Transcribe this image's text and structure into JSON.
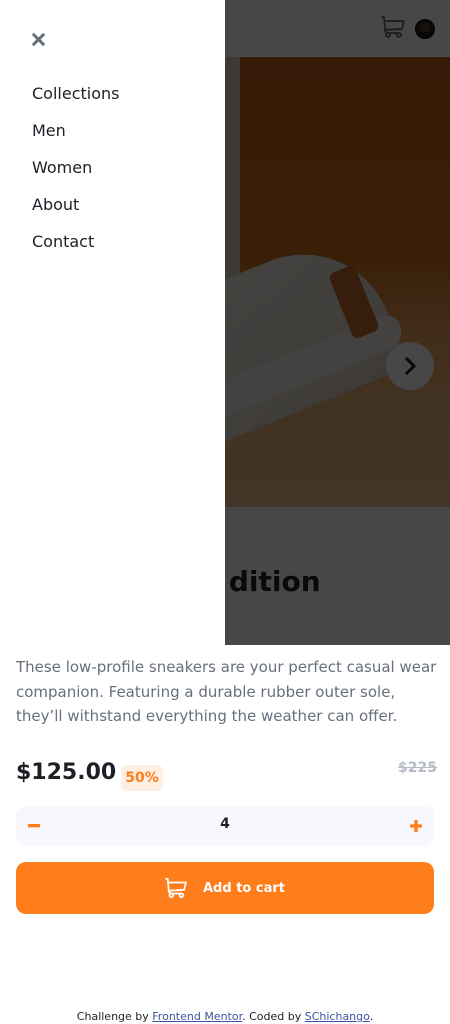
{
  "header": {
    "cart_icon": "cart-icon",
    "avatar": "user-avatar"
  },
  "hero": {
    "next_icon": "chevron-right-icon"
  },
  "product": {
    "title": "Fall Limited Edition Sneakers",
    "visible_title_fragment": "dition",
    "description": "These low-profile sneakers are your perfect casual wear companion. Featuring a durable rubber outer sole, they’ll withstand everything the weather can offer.",
    "price": "$125.00",
    "discount": "50%",
    "original_price": "$225",
    "quantity": "4",
    "add_to_cart_label": "Add to cart"
  },
  "menu": {
    "items": [
      {
        "label": "Collections"
      },
      {
        "label": "Men"
      },
      {
        "label": "Women"
      },
      {
        "label": "About"
      },
      {
        "label": "Contact"
      }
    ]
  },
  "footer": {
    "prefix": "Challenge by ",
    "link1": "Frontend Mentor",
    "middle": ". Coded by ",
    "link2": "SChichango",
    "suffix": "."
  },
  "colors": {
    "accent": "#ff7d1a",
    "accent_pale": "#ffeee2",
    "text_dark": "#1d2026",
    "text_grey": "#68707d",
    "muted": "#b6bcc8",
    "overlay": "rgba(0,0,0,0.72)"
  }
}
